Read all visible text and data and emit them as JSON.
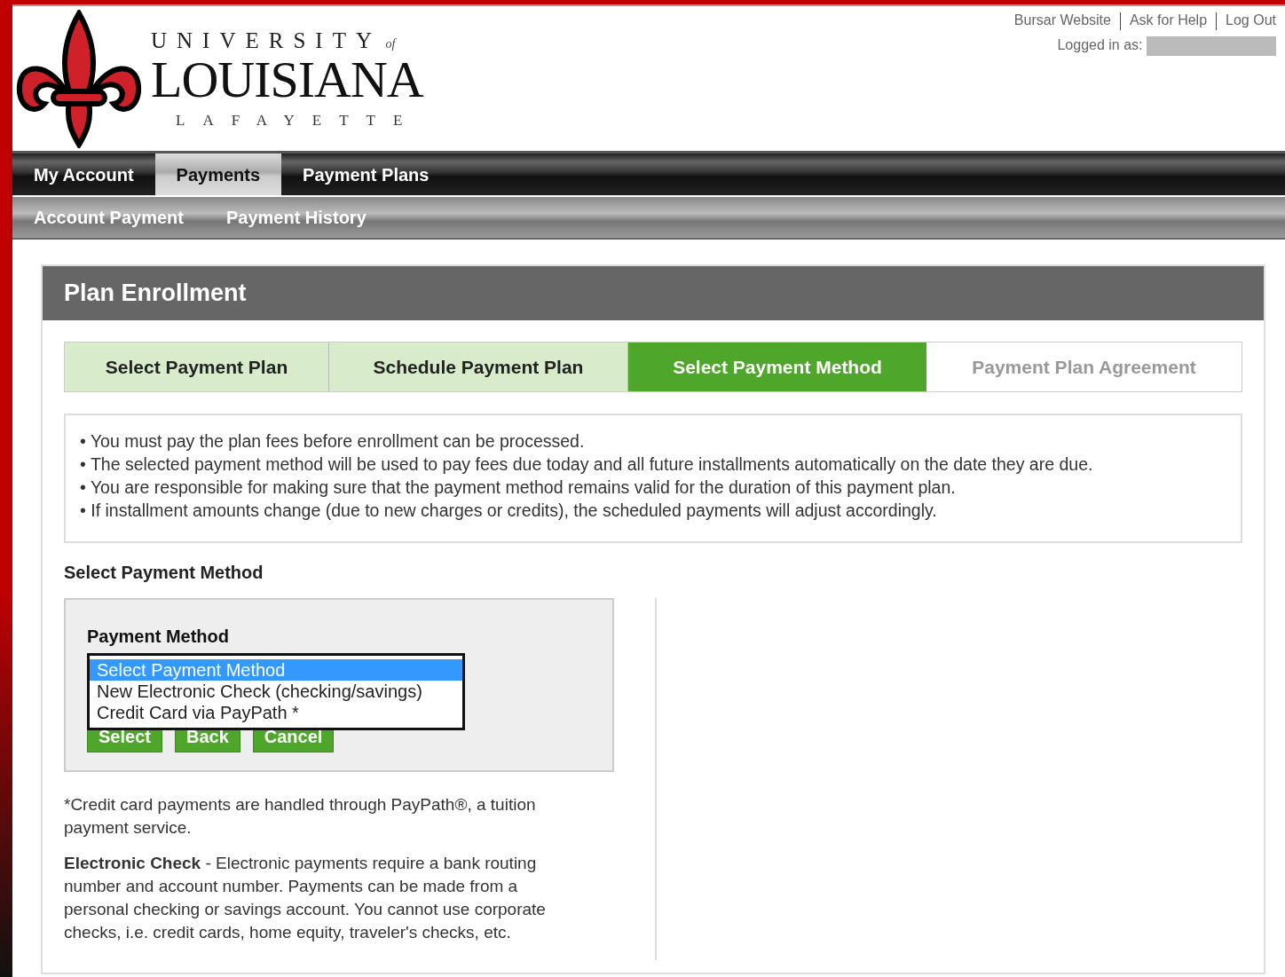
{
  "header": {
    "logo": {
      "line_top": "UNIVERSITY",
      "line_top_small": "of",
      "line_main": "LOUISIANA",
      "line_bottom": "LAFAYETTE"
    },
    "links": [
      "Bursar Website",
      "Ask for Help",
      "Log Out"
    ],
    "logged_in_label": "Logged in as:"
  },
  "main_nav": [
    {
      "label": "My Account",
      "selected": false
    },
    {
      "label": "Payments",
      "selected": true
    },
    {
      "label": "Payment Plans",
      "selected": false
    }
  ],
  "sub_nav": [
    {
      "label": "Account Payment"
    },
    {
      "label": "Payment History"
    }
  ],
  "panel": {
    "title": "Plan Enrollment",
    "steps": [
      {
        "label": "Select Payment Plan",
        "selected": false,
        "completed": true
      },
      {
        "label": "Schedule Payment Plan",
        "selected": false,
        "completed": true
      },
      {
        "label": "Select Payment Method",
        "selected": true
      },
      {
        "label": "Payment Plan Agreement",
        "selected": false,
        "completed": false
      }
    ],
    "notices": [
      "• You must pay the plan fees before enrollment can be processed.",
      "• The selected payment method will be used to pay fees due today and all future installments automatically on the date they are due.",
      "• You are responsible for making sure that the payment method remains valid for the duration of this payment plan.",
      "• If installment amounts change (due to new charges or credits), the scheduled payments will adjust accordingly."
    ],
    "section_title": "Select Payment Method",
    "form": {
      "label": "Payment Method",
      "options": [
        {
          "label": "Select Payment Method",
          "selected": true
        },
        {
          "label": "New Electronic Check (checking/savings)",
          "selected": false
        },
        {
          "label": "Credit Card via PayPath *",
          "selected": false
        }
      ],
      "buttons": [
        "Select",
        "Back",
        "Cancel"
      ]
    },
    "notes": [
      "*Credit card payments are handled through PayPath®, a tuition payment service.",
      "**Electronic Check** - Electronic payments require a bank routing number and account number. Payments can be made from a personal checking or savings account. You cannot use corporate checks, i.e. credit cards, home equity, traveler's checks, etc."
    ]
  }
}
